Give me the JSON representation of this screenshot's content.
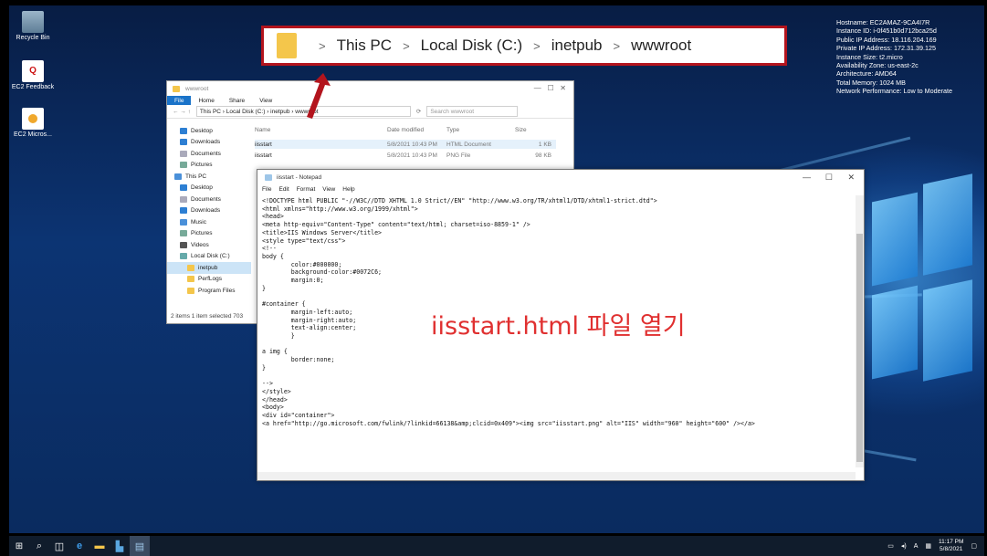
{
  "desktop": {
    "icons": [
      {
        "label": "Recycle Bin"
      },
      {
        "label": "EC2 Feedback"
      },
      {
        "label": "EC2 Micros..."
      }
    ],
    "sysinfo": [
      "Hostname: EC2AMAZ-9CA4I7R",
      "Instance ID: i-0f451b0d712bca25d",
      "Public IP Address: 18.116.204.169",
      "Private IP Address: 172.31.39.125",
      "Instance Size: t2.micro",
      "Availability Zone: us-east-2c",
      "Architecture: AMD64",
      "Total Memory: 1024 MB",
      "Network Performance: Low to Moderate"
    ]
  },
  "callout": {
    "crumbs": [
      "This PC",
      "Local Disk (C:)",
      "inetpub",
      "wwwroot"
    ],
    "separator": ">",
    "color": "#b3141d"
  },
  "explorer": {
    "title": "wwwroot",
    "ribbon": [
      "File",
      "Home",
      "Share",
      "View"
    ],
    "address": "This PC  ›  Local Disk (C:)  ›  inetpub  ›  wwwroot",
    "search_placeholder": "Search wwwroot",
    "sidebar": [
      "Desktop",
      "Downloads",
      "Documents",
      "Pictures",
      "This PC",
      "Desktop",
      "Documents",
      "Downloads",
      "Music",
      "Pictures",
      "Videos",
      "Local Disk (C:)",
      "inetpub",
      "PerfLogs",
      "Program Files"
    ],
    "columns": [
      "Name",
      "Date modified",
      "Type",
      "Size"
    ],
    "files": [
      {
        "name": "iisstart",
        "date": "5/8/2021 10:43 PM",
        "type": "HTML Document",
        "size": "1 KB"
      },
      {
        "name": "iisstart",
        "date": "5/8/2021 10:43 PM",
        "type": "PNG File",
        "size": "98 KB"
      }
    ],
    "status": "2 items    1 item selected  703"
  },
  "notepad": {
    "title": "iisstart - Notepad",
    "menu": [
      "File",
      "Edit",
      "Format",
      "View",
      "Help"
    ],
    "content": "<!DOCTYPE html PUBLIC \"-//W3C//DTD XHTML 1.0 Strict//EN\" \"http://www.w3.org/TR/xhtml1/DTD/xhtml1-strict.dtd\">\n<html xmlns=\"http://www.w3.org/1999/xhtml\">\n<head>\n<meta http-equiv=\"Content-Type\" content=\"text/html; charset=iso-8859-1\" />\n<title>IIS Windows Server</title>\n<style type=\"text/css\">\n<!--\nbody {\n\tcolor:#000000;\n\tbackground-color:#0072C6;\n\tmargin:0;\n}\n\n#container {\n\tmargin-left:auto;\n\tmargin-right:auto;\n\ttext-align:center;\n\t}\n\na img {\n\tborder:none;\n}\n\n-->\n</style>\n</head>\n<body>\n<div id=\"container\">\n<a href=\"http://go.microsoft.com/fwlink/?linkid=66138&amp;clcid=0x409\"><img src=\"iisstart.png\" alt=\"IIS\" width=\"960\" height=\"600\" /></a>"
  },
  "annotation": {
    "text": "iisstart.html 파일 열기",
    "color": "#e03030"
  },
  "taskbar": {
    "tray_lang": "A",
    "time": "11:17 PM",
    "date": "5/8/2021"
  }
}
